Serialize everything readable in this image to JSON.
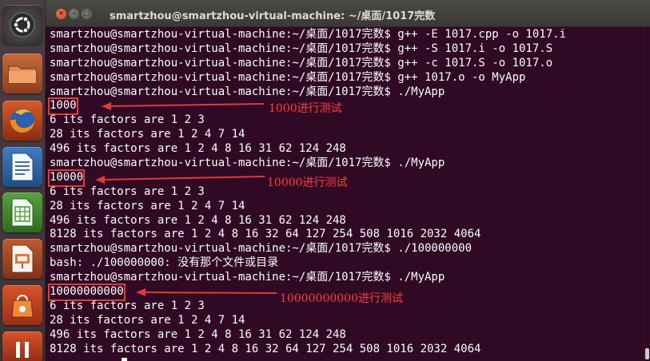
{
  "window": {
    "title": "smartzhou@smartzhou-virtual-machine: ~/桌面/1017完数",
    "close_glyph": "×",
    "min_glyph": "–",
    "max_glyph": "□"
  },
  "launcher": {
    "items": [
      {
        "name": "dash-home",
        "icon": "ubuntu-logo-icon"
      },
      {
        "name": "files",
        "icon": "folder-icon"
      },
      {
        "name": "firefox",
        "icon": "firefox-icon"
      },
      {
        "name": "libreoffice-writer",
        "icon": "writer-icon"
      },
      {
        "name": "libreoffice-calc",
        "icon": "calc-icon"
      },
      {
        "name": "libreoffice-impress",
        "icon": "impress-icon"
      },
      {
        "name": "ubuntu-software-center",
        "icon": "shopping-bag-icon"
      },
      {
        "name": "software-updater",
        "icon": "update-icon"
      }
    ]
  },
  "terminal": {
    "lines": [
      "smartzhou@smartzhou-virtual-machine:~/桌面/1017完数$ g++ -E 1017.cpp -o 1017.i",
      "smartzhou@smartzhou-virtual-machine:~/桌面/1017完数$ g++ -S 1017.i -o 1017.S",
      "smartzhou@smartzhou-virtual-machine:~/桌面/1017完数$ g++ -c 1017.S -o 1017.o",
      "smartzhou@smartzhou-virtual-machine:~/桌面/1017完数$ g++ 1017.o -o MyApp",
      "smartzhou@smartzhou-virtual-machine:~/桌面/1017完数$ ./MyApp",
      "1000",
      "6 its factors are 1 2 3",
      "28 its factors are 1 2 4 7 14",
      "496 its factors are 1 2 4 8 16 31 62 124 248",
      "smartzhou@smartzhou-virtual-machine:~/桌面/1017完数$ ./MyApp",
      "10000",
      "6 its factors are 1 2 3",
      "28 its factors are 1 2 4 7 14",
      "496 its factors are 1 2 4 8 16 31 62 124 248",
      "8128 its factors are 1 2 4 8 16 32 64 127 254 508 1016 2032 4064",
      "smartzhou@smartzhou-virtual-machine:~/桌面/1017完数$ ./100000000",
      "bash: ./100000000: 没有那个文件或目录",
      "smartzhou@smartzhou-virtual-machine:~/桌面/1017完数$ ./MyApp",
      "10000000000",
      "6 its factors are 1 2 3",
      "28 its factors are 1 2 4 7 14",
      "496 its factors are 1 2 4 8 16 31 62 124 248",
      "8128 its factors are 1 2 4 8 16 32 64 127 254 508 1016 2032 4064"
    ]
  },
  "annotations": [
    {
      "text": "1000进行测试"
    },
    {
      "text": "10000进行测试"
    },
    {
      "text": "10000000000进行测试"
    }
  ],
  "colors": {
    "terminal_bg": "#300a24",
    "terminal_fg": "#ffffff",
    "annotation_red": "#ff3c3c"
  }
}
